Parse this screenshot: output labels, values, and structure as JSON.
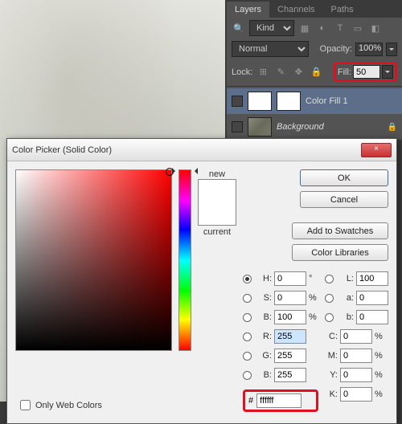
{
  "palette": {
    "tabs": [
      "Layers",
      "Channels",
      "Paths"
    ],
    "kind_label": "Kind",
    "blend_mode": "Normal",
    "opacity_label": "Opacity:",
    "opacity_value": "100%",
    "lock_label": "Lock:",
    "fill_label": "Fill:",
    "fill_value": "50",
    "layers": [
      {
        "name": "Color Fill 1",
        "italic": false
      },
      {
        "name": "Background",
        "italic": true
      }
    ]
  },
  "dialog": {
    "title": "Color Picker (Solid Color)",
    "close": "×",
    "new_label": "new",
    "current_label": "current",
    "buttons": {
      "ok": "OK",
      "cancel": "Cancel",
      "add": "Add to Swatches",
      "lib": "Color Libraries"
    },
    "hsb": {
      "h": "0",
      "s": "0",
      "b": "100"
    },
    "rgb": {
      "r": "255",
      "g": "255",
      "b": "255"
    },
    "lab": {
      "l": "100",
      "a": "0",
      "b": "0"
    },
    "cmyk": {
      "c": "0",
      "m": "0",
      "y": "0",
      "k": "0"
    },
    "hex_label": "#",
    "hex": "ffffff",
    "owc": "Only Web Colors"
  }
}
